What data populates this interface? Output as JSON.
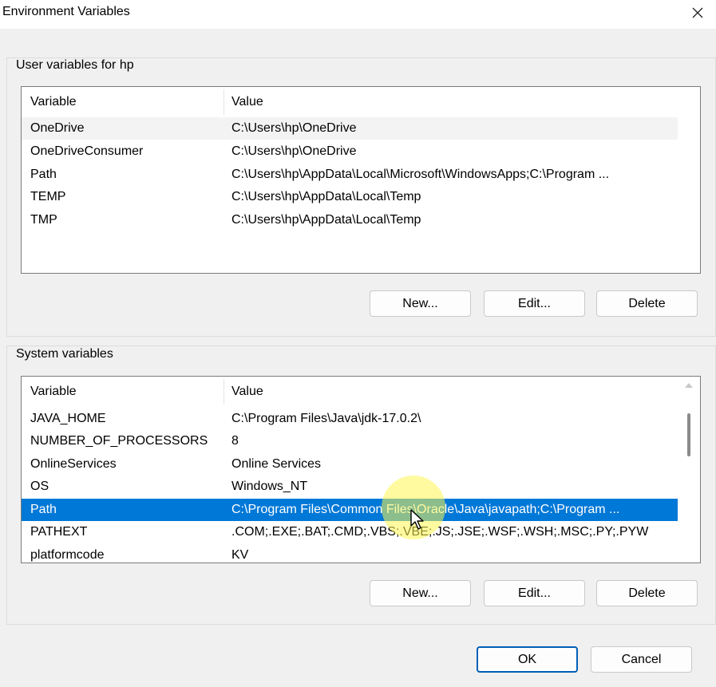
{
  "window": {
    "title": "Environment Variables"
  },
  "user_section": {
    "legend": "User variables for hp",
    "columns": {
      "variable": "Variable",
      "value": "Value"
    },
    "rows": [
      {
        "variable": "OneDrive",
        "value": "C:\\Users\\hp\\OneDrive"
      },
      {
        "variable": "OneDriveConsumer",
        "value": "C:\\Users\\hp\\OneDrive"
      },
      {
        "variable": "Path",
        "value": "C:\\Users\\hp\\AppData\\Local\\Microsoft\\WindowsApps;C:\\Program ..."
      },
      {
        "variable": "TEMP",
        "value": "C:\\Users\\hp\\AppData\\Local\\Temp"
      },
      {
        "variable": "TMP",
        "value": "C:\\Users\\hp\\AppData\\Local\\Temp"
      }
    ],
    "buttons": {
      "new": "New...",
      "edit": "Edit...",
      "delete": "Delete"
    }
  },
  "system_section": {
    "legend": "System variables",
    "columns": {
      "variable": "Variable",
      "value": "Value"
    },
    "rows": [
      {
        "variable": "JAVA_HOME",
        "value": "C:\\Program Files\\Java\\jdk-17.0.2\\"
      },
      {
        "variable": "NUMBER_OF_PROCESSORS",
        "value": "8"
      },
      {
        "variable": "OnlineServices",
        "value": "Online Services"
      },
      {
        "variable": "OS",
        "value": "Windows_NT"
      },
      {
        "variable": "Path",
        "value": "C:\\Program Files\\Common Files\\Oracle\\Java\\javapath;C:\\Program ..."
      },
      {
        "variable": "PATHEXT",
        "value": ".COM;.EXE;.BAT;.CMD;.VBS;.VBE;.JS;.JSE;.WSF;.WSH;.MSC;.PY;.PYW"
      },
      {
        "variable": "platformcode",
        "value": "KV"
      }
    ],
    "selected_row": "Path",
    "buttons": {
      "new": "New...",
      "edit": "Edit...",
      "delete": "Delete"
    }
  },
  "footer": {
    "ok": "OK",
    "cancel": "Cancel"
  },
  "colors": {
    "selection": "#0078d7",
    "accent_border": "#005fb8"
  },
  "icons": {
    "close": "close-icon",
    "scroll_up": "scroll-up-arrow-icon",
    "cursor": "mouse-pointer-icon"
  }
}
